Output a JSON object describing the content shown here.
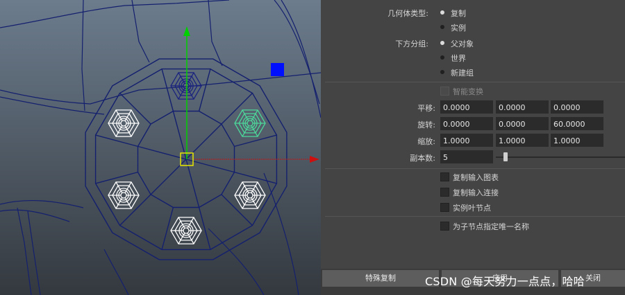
{
  "dialog": {
    "geometry_type_label": "几何体类型:",
    "geometry_options": [
      {
        "label": "复制",
        "selected": true
      },
      {
        "label": "实例",
        "selected": false
      }
    ],
    "group_under_label": "下方分组:",
    "group_options": [
      {
        "label": "父对象",
        "selected": true
      },
      {
        "label": "世界",
        "selected": false
      },
      {
        "label": "新建组",
        "selected": false
      }
    ],
    "smart_transform_label": "智能变换",
    "translate": {
      "label": "平移:",
      "values": [
        "0.0000",
        "0.0000",
        "0.0000"
      ]
    },
    "rotate": {
      "label": "旋转:",
      "values": [
        "0.0000",
        "0.0000",
        "60.0000"
      ]
    },
    "scale": {
      "label": "缩放:",
      "values": [
        "1.0000",
        "1.0000",
        "1.0000"
      ]
    },
    "copies": {
      "label": "副本数:",
      "value": "5"
    },
    "checkboxes": [
      {
        "label": "复制输入图表",
        "checked": false
      },
      {
        "label": "复制输入连接",
        "checked": false
      },
      {
        "label": "实例叶节点",
        "checked": false
      },
      {
        "label": "为子节点指定唯一名称",
        "checked": false
      }
    ],
    "buttons": {
      "special_duplicate": "特殊复制",
      "apply": "应用",
      "close": "关闭"
    }
  },
  "watermark": "CSDN @每天努力一点点，哈哈",
  "colors": {
    "panel_bg": "#444444",
    "field_bg": "#2b2b2b",
    "wire": "#1a237e",
    "selected": "#4cd89a",
    "manipulator_y": "#00d000",
    "manipulator_x": "#d00000"
  }
}
